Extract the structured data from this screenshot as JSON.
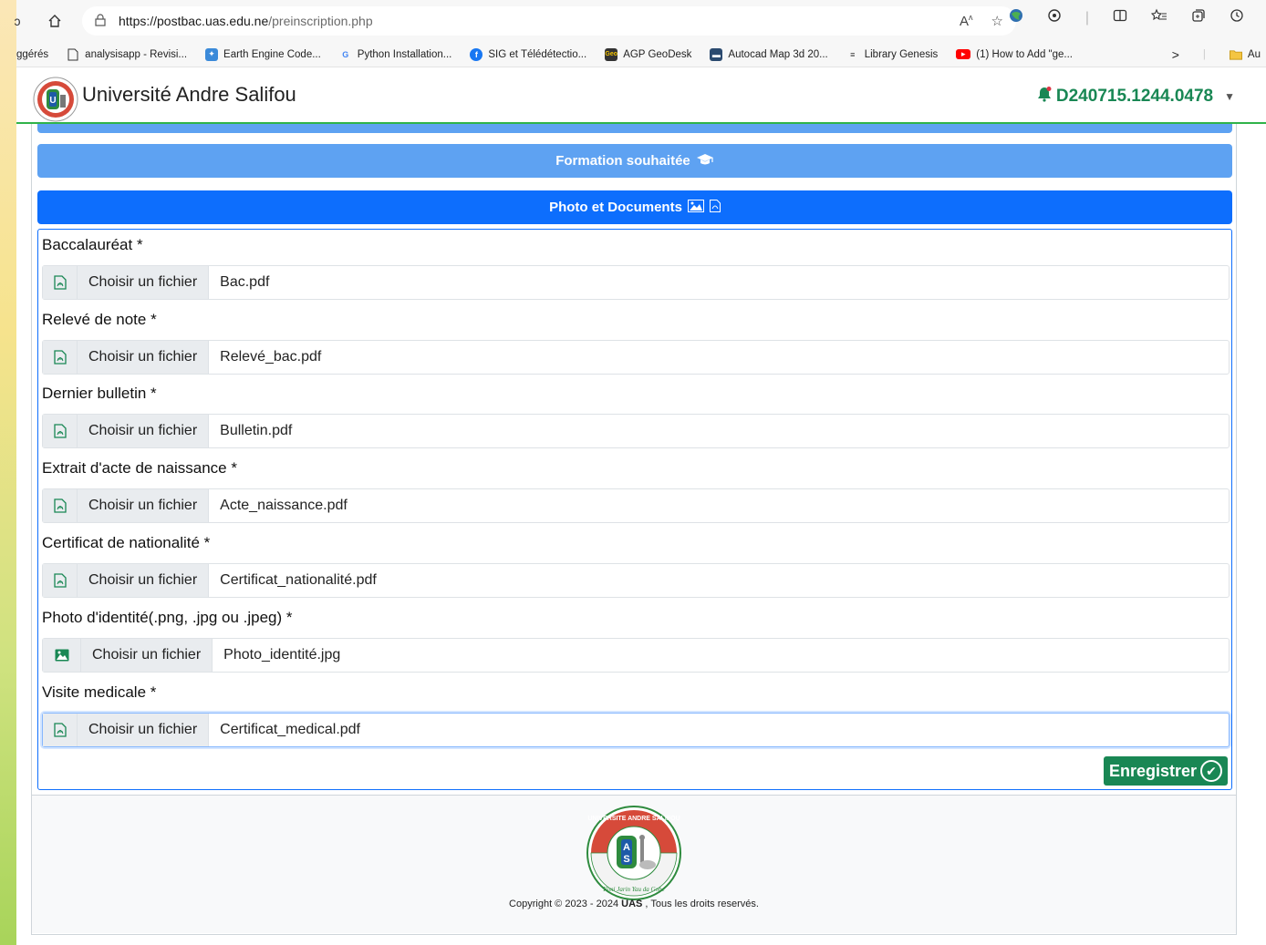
{
  "browser": {
    "url_host": "https://postbac.uas.edu.ne",
    "url_path": "/preinscription.php",
    "bookmarks": [
      {
        "label": "ggérés",
        "icon": "none"
      },
      {
        "label": "analysisapp - Revisi...",
        "icon": "page-icon"
      },
      {
        "label": "Earth Engine Code...",
        "icon": "earth-engine-icon"
      },
      {
        "label": "Python Installation...",
        "icon": "google-icon"
      },
      {
        "label": "SIG et Télédétectio...",
        "icon": "facebook-icon"
      },
      {
        "label": "AGP GeoDesk",
        "icon": "geodesk-icon"
      },
      {
        "label": "Autocad Map 3d 20...",
        "icon": "autocad-icon"
      },
      {
        "label": "Library Genesis",
        "icon": "library-icon"
      },
      {
        "label": "(1) How to Add \"ge...",
        "icon": "youtube-icon"
      }
    ],
    "bookmarks_more": "Au"
  },
  "navbar": {
    "brand": "Université Andre Salifou",
    "user_id": "D240715.1244.0478"
  },
  "sections": {
    "formation": "Formation souhaitée",
    "documents": "Photo et Documents"
  },
  "form": {
    "choose_label": "Choisir un fichier",
    "fields": [
      {
        "label": "Baccalauréat *",
        "file": "Bac.pdf",
        "icon": "pdf-icon"
      },
      {
        "label": "Relevé de note *",
        "file": "Relevé_bac.pdf",
        "icon": "pdf-icon"
      },
      {
        "label": "Dernier bulletin *",
        "file": "Bulletin.pdf",
        "icon": "pdf-icon"
      },
      {
        "label": "Extrait d'acte de naissance *",
        "file": "Acte_naissance.pdf",
        "icon": "pdf-icon"
      },
      {
        "label": "Certificat de nationalité *",
        "file": "Certificat_nationalité.pdf",
        "icon": "pdf-icon"
      },
      {
        "label": "Photo d'identité(.png, .jpg ou .jpeg) *",
        "file": "Photo_identité.jpg",
        "icon": "image-icon"
      },
      {
        "label": "Visite medicale *",
        "file": "Certificat_medical.pdf",
        "icon": "pdf-icon"
      }
    ],
    "save_label": "Enregistrer"
  },
  "footer": {
    "copyright_prefix": "Copyright © 2023 - 2024",
    "copyright_org": "UAS",
    "copyright_suffix": ", Tous les droits reservés."
  },
  "colors": {
    "primary": "#0d6efd",
    "primary_light": "#5ea2f2",
    "success": "#198754"
  }
}
